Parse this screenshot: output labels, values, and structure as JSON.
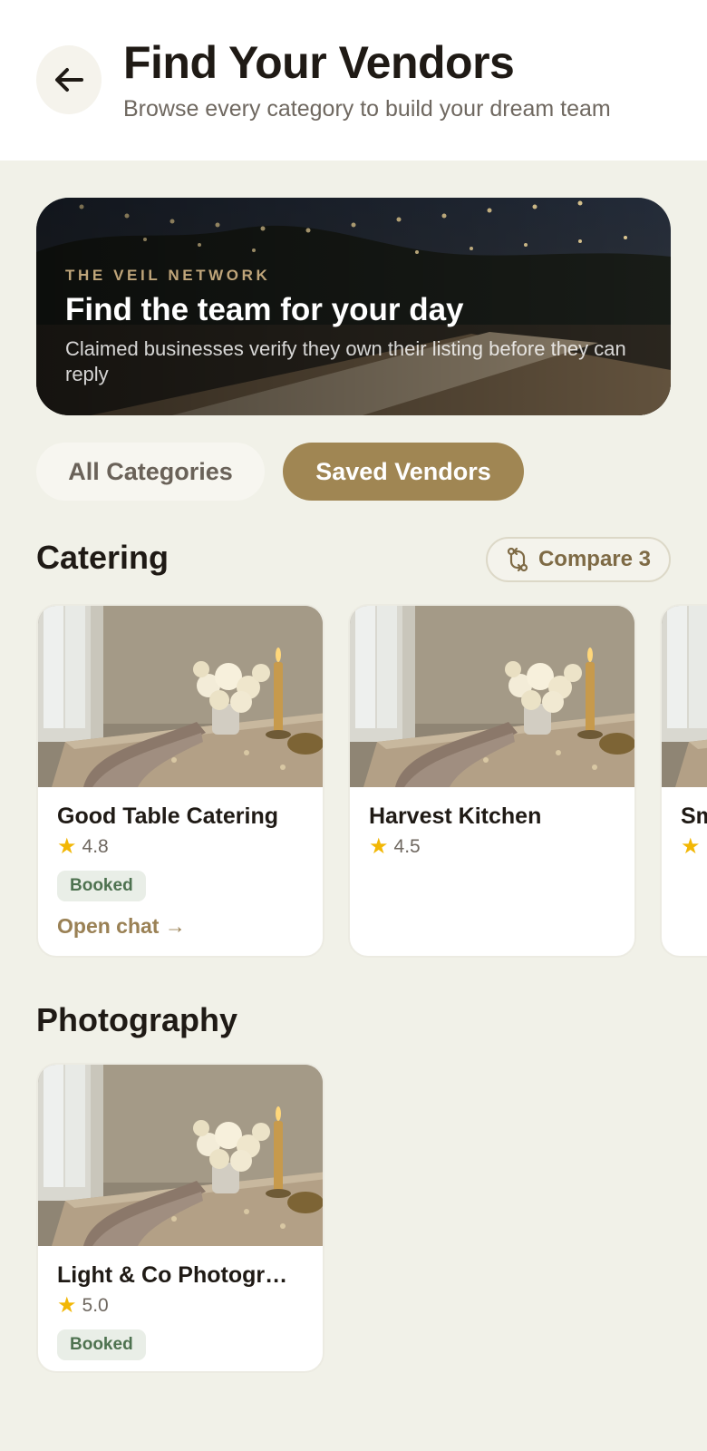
{
  "header": {
    "title": "Find Your Vendors",
    "subtitle": "Browse every category to build your dream team",
    "back_icon": "arrow-left-icon"
  },
  "hero": {
    "eyebrow": "THE VEIL NETWORK",
    "title": "Find the team for your day",
    "description": "Claimed businesses verify they own their listing before they can reply"
  },
  "filters": {
    "all_label": "All Categories",
    "saved_label": "Saved Vendors",
    "active": "Saved Vendors"
  },
  "sections": [
    {
      "title": "Catering",
      "compare_label": "Compare 3",
      "vendors": [
        {
          "name": "Good Table Catering",
          "rating": "4.8",
          "badge": "Booked",
          "link": "Open chat →"
        },
        {
          "name": "Harvest Kitchen",
          "rating": "4.5"
        },
        {
          "name": "Sm",
          "rating": ""
        }
      ]
    },
    {
      "title": "Photography",
      "vendors": [
        {
          "name": "Light & Co Photogr…",
          "rating": "5.0",
          "badge": "Booked"
        }
      ]
    }
  ],
  "colors": {
    "accent": "#a08653",
    "background": "#f1f1e8",
    "badge_text": "#4e7250",
    "star": "#f2b705"
  }
}
